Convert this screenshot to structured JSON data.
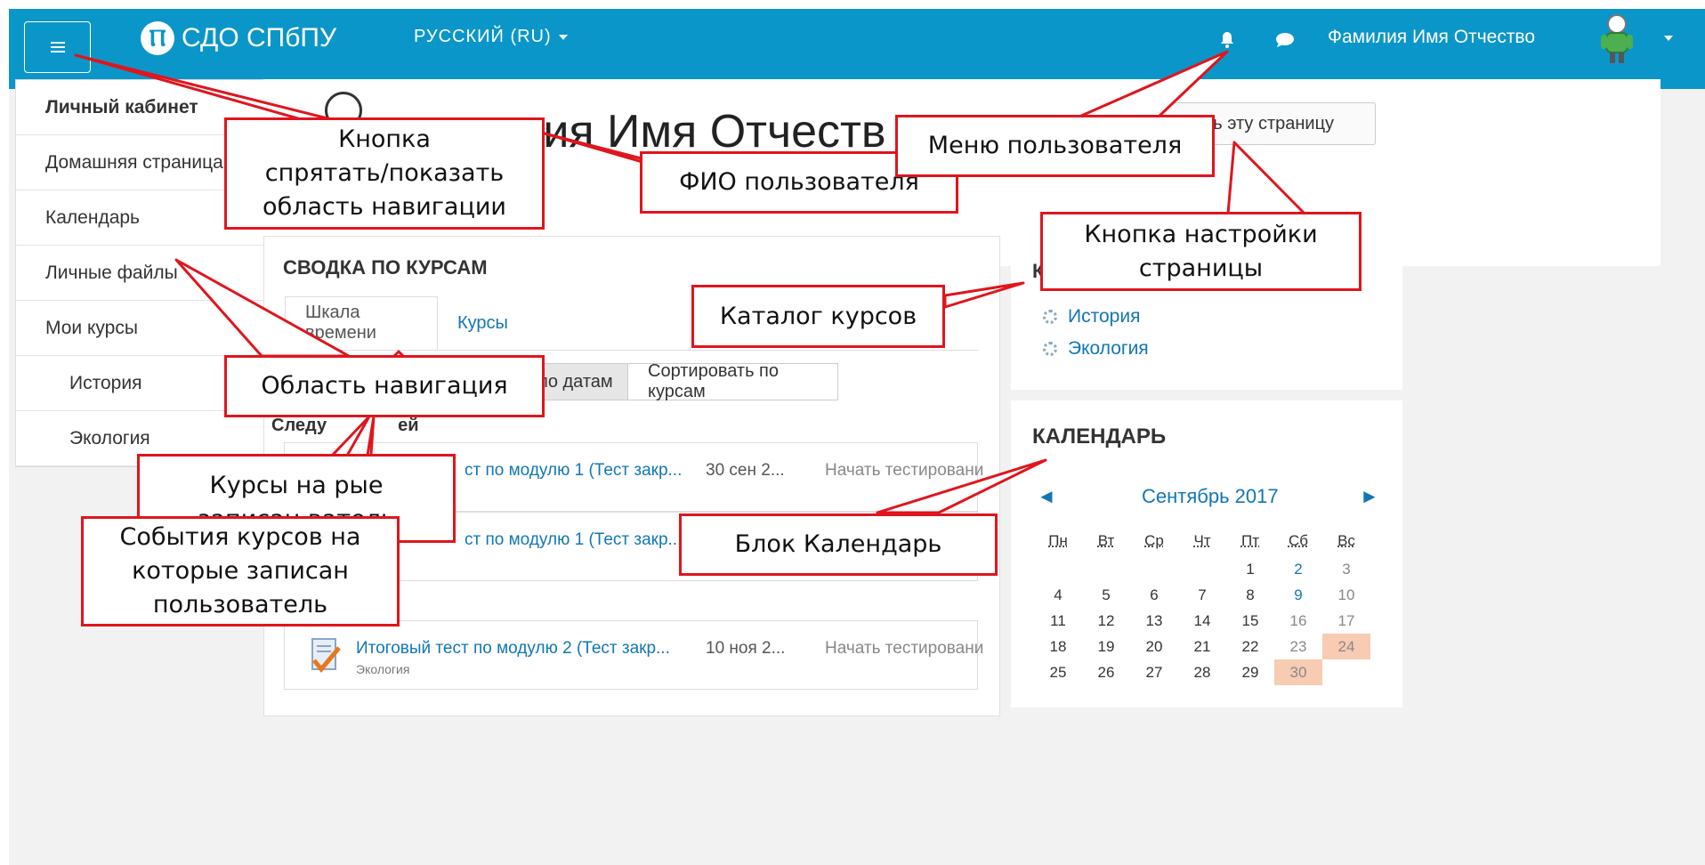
{
  "navbar": {
    "logo_mark": "Ⲡ",
    "logo_text": "СДО СПбПУ",
    "language": "РУССКИЙ (RU)",
    "user_name": "Фамилия Имя Отчество"
  },
  "sidebar": {
    "items": [
      {
        "label": "Личный кабинет"
      },
      {
        "label": "Домашняя страница"
      },
      {
        "label": "Календарь"
      },
      {
        "label": "Личные файлы"
      },
      {
        "label": "Мои курсы"
      },
      {
        "label": "История"
      },
      {
        "label": "Экология"
      }
    ]
  },
  "page": {
    "title": "лия Имя Отчеств",
    "settings_button": "ить эту страницу"
  },
  "overview": {
    "title": "СВОДКА ПО КУРСАМ",
    "tabs": [
      "Шкала времени",
      "Курсы"
    ],
    "sort_buttons": [
      "по датам",
      "Сортировать по курсам"
    ],
    "next_label": "Следу",
    "next_label_tail": "ей",
    "events": [
      {
        "name": "ст по модулю 1 (Тест закр...",
        "course": "",
        "date": "30 сен 2...",
        "action": "Начать тестировани"
      },
      {
        "name": "ст по модулю 1 (Тест закр...",
        "course": "ия",
        "date": "",
        "action": ""
      },
      {
        "name": "Итоговый тест по модулю 2 (Тест закр...",
        "course": "Экология",
        "date": "10 ноя 2...",
        "action": "Начать тестировани"
      }
    ]
  },
  "catalog": {
    "title": "К",
    "items": [
      "История",
      "Экология"
    ]
  },
  "calendar": {
    "title": "КАЛЕНДАРЬ",
    "prev": "◄",
    "next": "►",
    "month": "Сентябрь 2017",
    "weekdays": [
      "Пн",
      "Вт",
      "Ср",
      "Чт",
      "Пт",
      "Сб",
      "Вс"
    ],
    "weeks": [
      [
        "",
        "",
        "",
        "",
        "1",
        "2",
        "3"
      ],
      [
        "4",
        "5",
        "6",
        "7",
        "8",
        "9",
        "10"
      ],
      [
        "11",
        "12",
        "13",
        "14",
        "15",
        "16",
        "17"
      ],
      [
        "18",
        "19",
        "20",
        "21",
        "22",
        "23",
        "24"
      ],
      [
        "25",
        "26",
        "27",
        "28",
        "29",
        "30",
        ""
      ]
    ],
    "highlighted_days": [
      "24",
      "30"
    ],
    "highlight_color": "#f8cbb3"
  },
  "callouts": {
    "hide_nav": "Кнопка\nспрятать/показать\nобласть навигации",
    "user_fio": "ФИО пользователя",
    "user_menu": "Меню пользователя",
    "page_settings": "Кнопка настройки\nстраницы",
    "course_catalog": "Каталог курсов",
    "nav_area": "Область навигация",
    "my_courses": "Курсы на      рые\nзаписан           ватель",
    "course_events": "События курсов на\nкоторые записан\nпользователь",
    "calendar_block": "Блок Календарь"
  },
  "colors": {
    "navbar": "#0b96c9",
    "link": "#1177b3",
    "callout_border": "#e0151d"
  }
}
